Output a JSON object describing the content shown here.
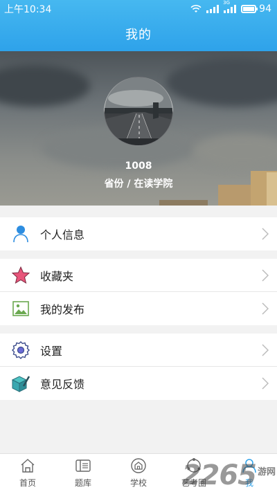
{
  "status_bar": {
    "time": "上午10:34",
    "battery": "94",
    "network": "3G"
  },
  "header": {
    "title": "我的"
  },
  "profile": {
    "name": "1008",
    "subtitle": "省份 / 在读学院"
  },
  "menu": {
    "group1": [
      {
        "label": "个人信息",
        "icon": "person-icon"
      }
    ],
    "group2": [
      {
        "label": "收藏夹",
        "icon": "star-icon"
      },
      {
        "label": "我的发布",
        "icon": "picture-icon"
      }
    ],
    "group3": [
      {
        "label": "设置",
        "icon": "gear-icon"
      },
      {
        "label": "意见反馈",
        "icon": "feedback-icon"
      }
    ]
  },
  "tabs": [
    {
      "label": "首页",
      "icon": "home-icon"
    },
    {
      "label": "题库",
      "icon": "question-bank-icon"
    },
    {
      "label": "学校",
      "icon": "school-icon"
    },
    {
      "label": "艺考圈",
      "icon": "circle-icon"
    },
    {
      "label": "我",
      "icon": "me-icon",
      "active": true
    }
  ],
  "watermark": {
    "text": "2265",
    "suffix": "游网"
  },
  "colors": {
    "accent": "#2ea2ea",
    "star": "#e8557a"
  }
}
